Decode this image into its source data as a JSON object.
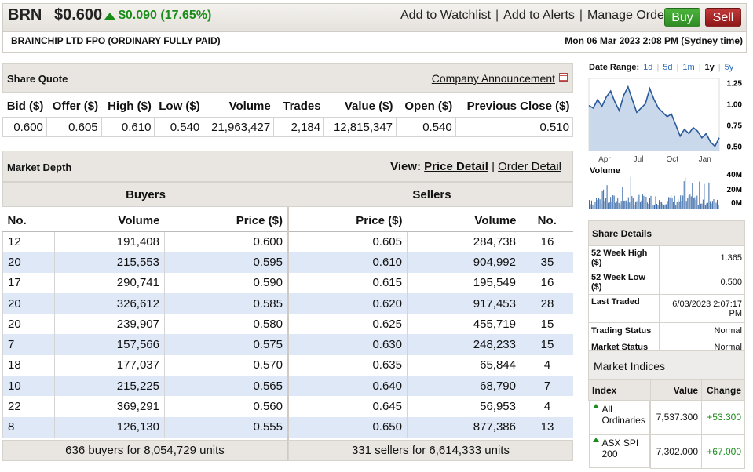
{
  "quote": {
    "code": "BRN",
    "price": "$0.600",
    "change": "$0.090 (17.65%)",
    "company": "BRAINCHIP LTD FPO (ORDINARY FULLY PAID)",
    "datetime": "Mon 06 Mar 2023 2:08 PM (Sydney time)"
  },
  "header_links": {
    "watchlist": "Add to Watchlist",
    "alerts": "Add to Alerts",
    "orders": "Manage Orders",
    "buy": "Buy",
    "sell": "Sell"
  },
  "share_quote": {
    "title": "Share Quote",
    "announcement": "Company Announcement",
    "columns": [
      "Bid ($)",
      "Offer ($)",
      "High ($)",
      "Low ($)",
      "Volume",
      "Trades",
      "Value ($)",
      "Open ($)",
      "Previous Close ($)"
    ],
    "values": [
      "0.600",
      "0.605",
      "0.610",
      "0.540",
      "21,963,427",
      "2,184",
      "12,815,347",
      "0.540",
      "0.510"
    ]
  },
  "market_depth": {
    "title": "Market Depth",
    "view_label": "View:",
    "price_detail": "Price Detail",
    "order_detail": "Order Detail",
    "separator": "|",
    "buyers_label": "Buyers",
    "sellers_label": "Sellers",
    "buy_cols": [
      "No.",
      "Volume",
      "Price ($)"
    ],
    "sell_cols": [
      "Price ($)",
      "Volume",
      "No."
    ],
    "buyers": [
      [
        "12",
        "191,408",
        "0.600"
      ],
      [
        "20",
        "215,553",
        "0.595"
      ],
      [
        "17",
        "290,741",
        "0.590"
      ],
      [
        "20",
        "326,612",
        "0.585"
      ],
      [
        "20",
        "239,907",
        "0.580"
      ],
      [
        "7",
        "157,566",
        "0.575"
      ],
      [
        "18",
        "177,037",
        "0.570"
      ],
      [
        "10",
        "215,225",
        "0.565"
      ],
      [
        "22",
        "369,291",
        "0.560"
      ],
      [
        "8",
        "126,130",
        "0.555"
      ]
    ],
    "sellers": [
      [
        "0.605",
        "284,738",
        "16"
      ],
      [
        "0.610",
        "904,992",
        "35"
      ],
      [
        "0.615",
        "195,549",
        "16"
      ],
      [
        "0.620",
        "917,453",
        "28"
      ],
      [
        "0.625",
        "455,719",
        "15"
      ],
      [
        "0.630",
        "248,233",
        "15"
      ],
      [
        "0.635",
        "65,844",
        "4"
      ],
      [
        "0.640",
        "68,790",
        "7"
      ],
      [
        "0.645",
        "56,953",
        "4"
      ],
      [
        "0.650",
        "877,386",
        "13"
      ]
    ],
    "buyers_total": "636 buyers for 8,054,729 units",
    "sellers_total": "331 sellers for 6,614,333 units"
  },
  "chart": {
    "date_range_label": "Date Range:",
    "ranges": [
      "1d",
      "5d",
      "1m",
      "1y",
      "5y"
    ],
    "active_range": "1y",
    "x_ticks": [
      "Apr",
      "Jul",
      "Oct",
      "Jan"
    ],
    "y_ticks": [
      "1.25",
      "1.00",
      "0.75",
      "0.50"
    ],
    "volume_label": "Volume",
    "volume_ticks": [
      "40M",
      "20M",
      "0M"
    ],
    "line_color": "#2a5a9a"
  },
  "chart_data": {
    "type": "line",
    "series": [
      {
        "values": [
          0.98,
          0.95,
          1.05,
          0.97,
          1.08,
          1.15,
          1.02,
          0.92,
          1.1,
          1.2,
          1.05,
          0.9,
          0.95,
          1.0,
          1.18,
          1.05,
          0.95,
          0.9,
          0.85,
          0.88,
          0.75,
          0.62,
          0.7,
          0.65,
          0.72,
          0.68,
          0.6,
          0.65,
          0.55,
          0.5,
          0.6
        ]
      }
    ],
    "ylim": [
      0.45,
      1.3
    ]
  },
  "share_details": {
    "title": "Share Details",
    "rows": [
      [
        "52 Week High ($)",
        "1.365"
      ],
      [
        "52 Week Low ($)",
        "0.500"
      ],
      [
        "Last Traded",
        "6/03/2023 2:07:17 PM"
      ],
      [
        "Trading Status",
        "Normal"
      ],
      [
        "Market Status",
        "Normal"
      ]
    ]
  },
  "market_indices": {
    "title": "Market Indices",
    "columns": [
      "Index",
      "Value",
      "Change"
    ],
    "rows": [
      [
        "All Ordinaries",
        "7,537.300",
        "+53.300"
      ],
      [
        "ASX SPI 200",
        "7,302.000",
        "+67.000"
      ]
    ],
    "up_color": "#198c19"
  }
}
